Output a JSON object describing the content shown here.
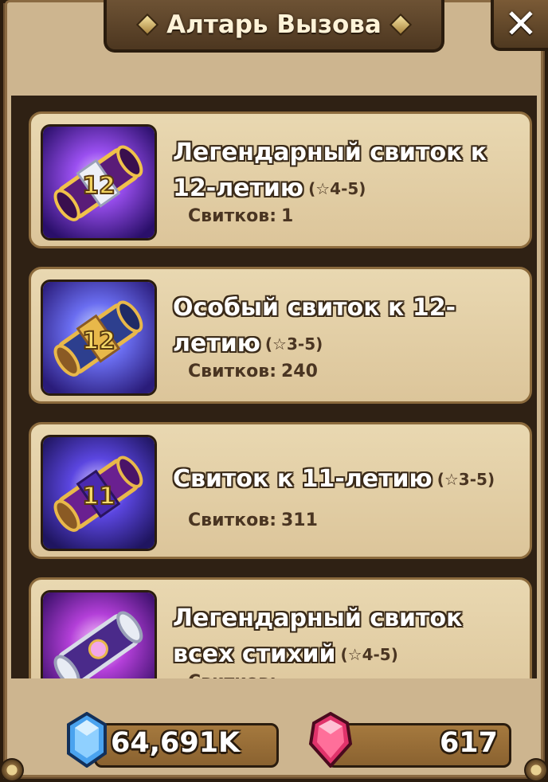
{
  "window": {
    "title": "Алтарь Вызова",
    "close_label": "✕"
  },
  "scrolls": [
    {
      "name": "Легендарный свиток к 12-летию",
      "stars": "(☆4-5)",
      "count_label": "Свитков:",
      "count": "1",
      "icon": "legendary-scroll-12-icon",
      "accent": "#7a2fd0"
    },
    {
      "name": "Особый свиток к 12-летию",
      "stars": "(☆3-5)",
      "count_label": "Свитков:",
      "count": "240",
      "icon": "special-scroll-12-icon",
      "accent": "#3a66d6"
    },
    {
      "name": "Свиток к 11-летию",
      "stars": "(☆3-5)",
      "count_label": "Свитков:",
      "count": "311",
      "icon": "scroll-11-icon",
      "accent": "#5a3fd8"
    },
    {
      "name": "Легендарный свиток всех стихий",
      "stars": "(☆4-5)",
      "count_label": "Свитков:",
      "count": "",
      "icon": "legendary-elements-scroll-icon",
      "accent": "#b33fd8"
    }
  ],
  "currencies": {
    "crystals": {
      "value": "64,691K",
      "icon": "blue-crystal-icon",
      "color": "#4aa3ef"
    },
    "gems": {
      "value": "617",
      "icon": "red-gem-icon",
      "color": "#e0336b"
    }
  }
}
